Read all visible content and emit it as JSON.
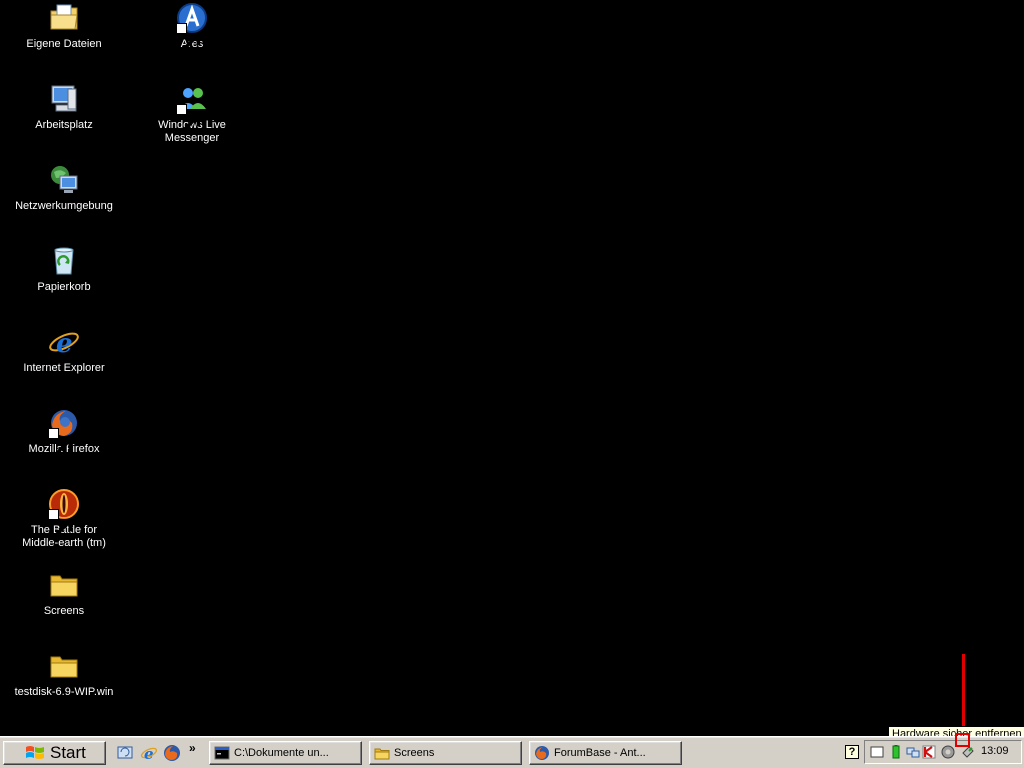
{
  "desktop": {
    "icons": [
      {
        "label": "Eigene Dateien",
        "icon": "my-documents-icon"
      },
      {
        "label": "Ares",
        "icon": "ares-icon"
      },
      {
        "label": "Arbeitsplatz",
        "icon": "my-computer-icon"
      },
      {
        "label": "Windows Live Messenger",
        "icon": "messenger-icon"
      },
      {
        "label": "Netzwerkumgebung",
        "icon": "network-places-icon"
      },
      {
        "label": "Papierkorb",
        "icon": "recycle-bin-icon"
      },
      {
        "label": "Internet Explorer",
        "icon": "internet-explorer-icon"
      },
      {
        "label": "Mozilla Firefox",
        "icon": "firefox-icon"
      },
      {
        "label": "The Battle for\nMiddle-earth (tm)",
        "icon": "battle-middle-earth-icon"
      },
      {
        "label": "Screens",
        "icon": "folder-icon"
      },
      {
        "label": "testdisk-6.9-WIP.win",
        "icon": "folder-icon"
      }
    ]
  },
  "taskbar": {
    "start_label": "Start",
    "quicklaunch_more": "»",
    "tasks": [
      {
        "label": "C:\\Dokumente un...",
        "icon": "console-icon"
      },
      {
        "label": "Screens",
        "icon": "folder-icon"
      },
      {
        "label": "ForumBase - Ant...",
        "icon": "firefox-icon"
      }
    ],
    "help_label": "?",
    "clock": "13:09"
  },
  "tooltip": {
    "text": "Hardware sicher entfernen"
  },
  "colors": {
    "desktop_bg": "#000000",
    "taskbar_bg": "#d4d0c8",
    "marker": "#e00000",
    "tooltip_bg": "#ffffe1"
  }
}
